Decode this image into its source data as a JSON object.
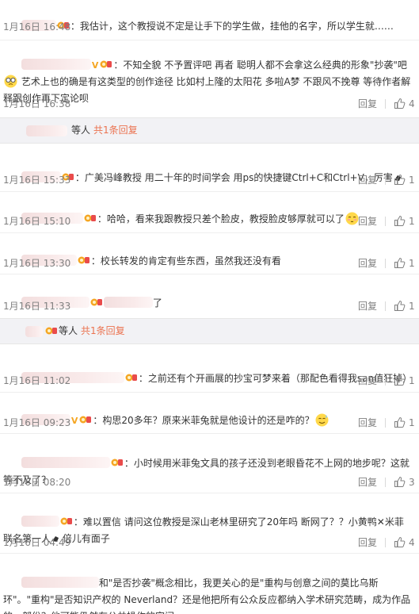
{
  "reply_label": "回复",
  "colors": {
    "link": "#eb7350",
    "meta": "#808080",
    "text": "#333333",
    "subbar": "#f2f2f5"
  },
  "comments": [
    {
      "text": "：我估计，这个教授说不定是让手下的学生做，挂他的名字，所以学生就……",
      "time": "1月16日 16:48",
      "likes": ""
    },
    {
      "text_a": "：不知全貌 不予置评吧 再者 聪明人都不会拿这么经典的形象\"抄袭\"吧",
      "text_b": "艺术上也的确是有这类型的创作途径 比如村上隆的太阳花 多啦A梦 不跟风不挽尊 等待作者解释跟创作再下定论呗",
      "time": "1月16日 16:38",
      "likes": "4"
    },
    {
      "text_a": "：广美冯峰教授 用二十年的时间学会 用ps的快捷键Ctrl+C和Ctrl+V，厉害",
      "time": "1月16日 15:33",
      "likes": "1"
    },
    {
      "text": "：哈哈，看来我跟教授只差个脸皮，教授脸皮够厚就可以了",
      "time": "1月16日 15:10",
      "likes": "1"
    },
    {
      "text": "：校长转发的肯定有些东西，虽然我还没有看",
      "time": "1月16日 13:30",
      "likes": "1"
    },
    {
      "text": "了",
      "time": "1月16日 11:33",
      "likes": "1"
    },
    {
      "text": "：之前还有个开画展的抄宝可梦来着（那配色看得我san值狂掉）",
      "time": "1月16日 11:02",
      "likes": "1"
    },
    {
      "text": "：构思20多年？原来米菲兔就是他设计的还是咋的？",
      "time": "1月16日 09:23",
      "likes": "1"
    },
    {
      "text": "：小时候用米菲兔文具的孩子还没到老眼昏花不上网的地步呢？这就等不及了？",
      "time": "1月16日 08:20",
      "likes": "3"
    },
    {
      "text_a": "：难以置信 请问这位教授是深山老林里研究了20年吗 断网了？？小黄鸭✕米菲 联名第一人",
      "text_b": "倍儿有面子",
      "time": "1月16日 04:49",
      "likes": "4"
    },
    {
      "text": "和\"是否抄袭\"概念相比，我更关心的是\"重构与创意之间的莫比乌斯环\"。\"重构\"是否知识产权的 Neverland？还是他把所有公众反应都纳入学术研究范畴，成为作品的一部份？他可能仍然有公共操作的空间。"
    }
  ],
  "sub_replies": [
    {
      "label": "等人",
      "link": "共1条回复"
    },
    {
      "label": "等人",
      "link": "共1条回复"
    }
  ]
}
